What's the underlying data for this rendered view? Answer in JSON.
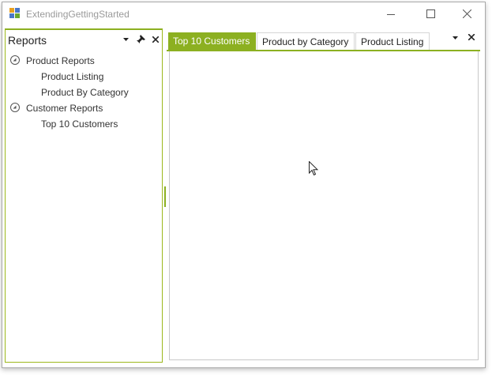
{
  "window": {
    "title": "ExtendingGettingStarted",
    "icon": "app-grid-icon",
    "controls": [
      "minimize-icon",
      "maximize-icon",
      "close-icon"
    ]
  },
  "reports_panel": {
    "title": "Reports",
    "header_buttons": [
      "dropdown-icon",
      "pin-icon",
      "close-icon"
    ],
    "tree": [
      {
        "label": "Product Reports",
        "expanded": true,
        "children": [
          "Product Listing",
          "Product By Category"
        ]
      },
      {
        "label": "Customer Reports",
        "expanded": true,
        "children": [
          "Top 10 Customers"
        ]
      }
    ]
  },
  "document_area": {
    "tabs": [
      {
        "label": "Top 10 Customers",
        "active": true
      },
      {
        "label": "Product by Category",
        "active": false
      },
      {
        "label": "Product Listing",
        "active": false
      }
    ],
    "tab_buttons": [
      "dropdown-icon",
      "close-icon"
    ]
  },
  "theme": {
    "accent": "#8cb021",
    "border": "#a9a9a9"
  }
}
